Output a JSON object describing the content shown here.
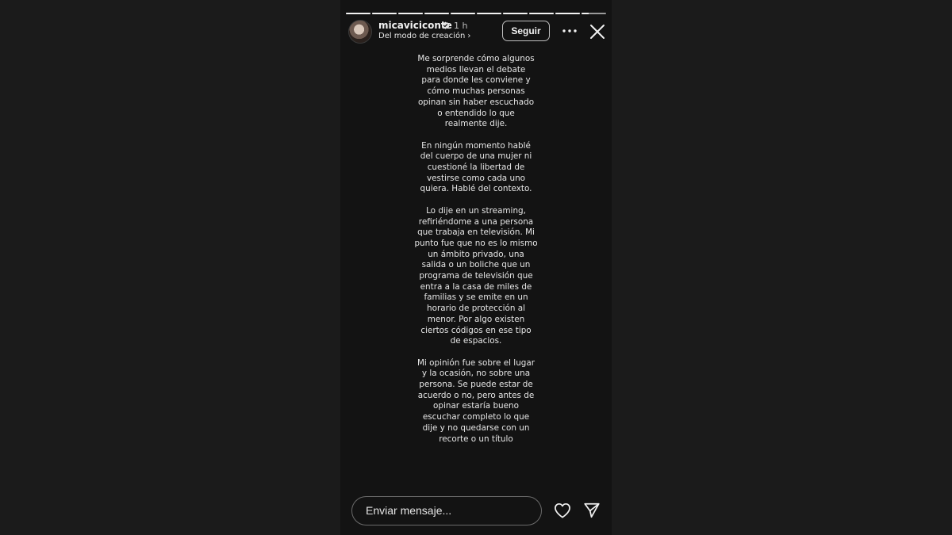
{
  "story": {
    "segments": [
      {
        "progress": 1.0
      },
      {
        "progress": 1.0
      },
      {
        "progress": 1.0
      },
      {
        "progress": 1.0
      },
      {
        "progress": 1.0
      },
      {
        "progress": 1.0
      },
      {
        "progress": 1.0
      },
      {
        "progress": 1.0
      },
      {
        "progress": 1.0
      },
      {
        "progress": 0.3
      }
    ],
    "colors": {
      "background": "#131313",
      "text": "#e6e6e6",
      "progress_active": "#f2f2f2",
      "progress_inactive": "#9a9a9a"
    }
  },
  "header": {
    "username": "micaviciconte",
    "verified_icon": "verified-badge-icon",
    "time": "1 h",
    "subtitle": "Del modo de creación",
    "subtitle_chevron": "›",
    "follow_label": "Seguir",
    "more_icon": "more-horizontal-icon",
    "close_icon": "close-icon"
  },
  "content": {
    "paragraphs": [
      "Me sorprende cómo algunos\nmedios llevan el debate\npara donde les conviene y\ncómo muchas personas\nopinan sin haber escuchado\no entendido lo que\nrealmente dije.",
      "En ningún momento hablé\ndel cuerpo de una mujer ni\ncuestioné la libertad de\nvestirse como cada uno\nquiera. Hablé del contexto.",
      "Lo dije en un streaming,\nrefiriéndome a una persona\nque trabaja en televisión. Mi\npunto fue que no es lo mismo\nun ámbito privado, una\nsalida o un boliche que un\nprograma de televisión que\nentra a la casa de miles de\nfamilias y se emite en un\nhorario de protección al\nmenor. Por algo existen\nciertos códigos en ese tipo\nde espacios.",
      "Mi opinión fue sobre el lugar\ny la ocasión, no sobre una\npersona. Se puede estar de\nacuerdo o no, pero antes de\nopinar estaría bueno\nescuchar completo lo que\ndije y no quedarse con un\nrecorte o un título"
    ]
  },
  "footer": {
    "message_placeholder": "Enviar mensaje...",
    "like_icon": "heart-icon",
    "send_icon": "send-icon"
  }
}
